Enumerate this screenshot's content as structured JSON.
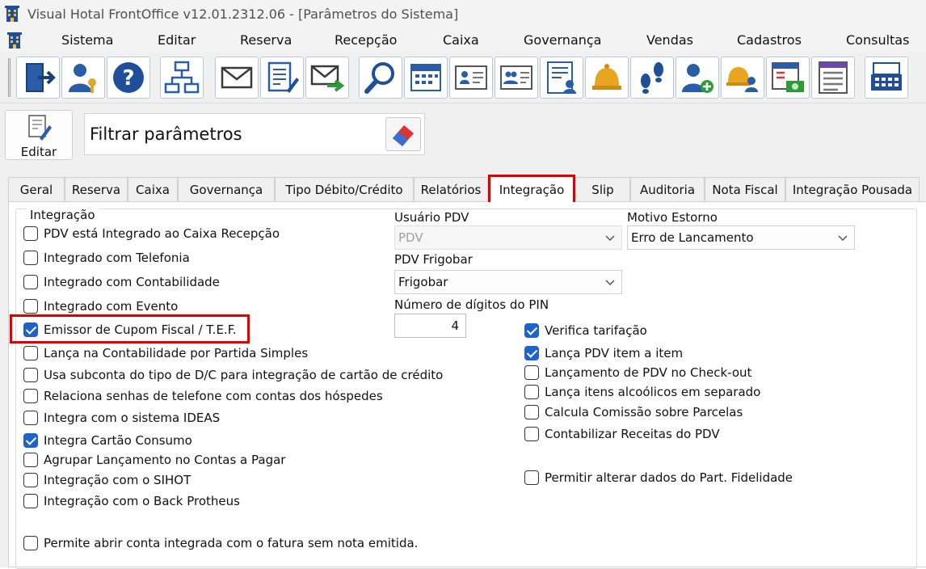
{
  "window": {
    "title": "Visual Hotal FrontOffice v12.01.2312.06 - [Parâmetros do Sistema]"
  },
  "menu": [
    {
      "label": "Sistema"
    },
    {
      "label": "Editar"
    },
    {
      "label": "Reserva"
    },
    {
      "label": "Recepção"
    },
    {
      "label": "Caixa"
    },
    {
      "label": "Governança"
    },
    {
      "label": "Vendas"
    },
    {
      "label": "Cadastros"
    },
    {
      "label": "Consultas"
    }
  ],
  "toolbar_icons": [
    "exit-door-icon",
    "user-key-icon",
    "help-icon",
    "org-chart-icon",
    "mail-icon",
    "document-edit-icon",
    "mail-forward-icon",
    "search-icon",
    "calendar-icon",
    "guest-card-icon",
    "guest-card-group-icon",
    "guest-list-icon",
    "bell-icon",
    "footprints-icon",
    "add-user-icon",
    "bell-group-icon",
    "invoice-cash-icon",
    "list-form-icon",
    "cash-register-icon"
  ],
  "filter": {
    "edit_label": "Editar",
    "filter_label": "Filtrar parâmetros"
  },
  "tabs": [
    {
      "label": "Geral"
    },
    {
      "label": "Reserva"
    },
    {
      "label": "Caixa"
    },
    {
      "label": "Governança"
    },
    {
      "label": "Tipo Débito/Crédito"
    },
    {
      "label": "Relatórios"
    },
    {
      "label": "Integração"
    },
    {
      "label": "Slip"
    },
    {
      "label": "Auditoria"
    },
    {
      "label": "Nota Fiscal"
    },
    {
      "label": "Integração Pousada"
    }
  ],
  "group": {
    "label": "Integração",
    "left_checks": [
      {
        "label": "PDV está Integrado ao Caixa Recepção",
        "checked": false
      },
      {
        "label": "Integrado com Telefonia",
        "checked": false
      },
      {
        "label": "Integrado com Contabilidade",
        "checked": false
      },
      {
        "label": "Integrado com Evento",
        "checked": false
      },
      {
        "label": "Emissor de Cupom Fiscal / T.E.F.",
        "checked": true
      },
      {
        "label": "Lança na Contabilidade por Partida Simples",
        "checked": false
      },
      {
        "label": "Usa subconta do tipo de D/C para integração de cartão de crédito",
        "checked": false
      },
      {
        "label": "Relaciona senhas de telefone com contas dos hóspedes",
        "checked": false
      },
      {
        "label": "Integra com o sistema IDEAS",
        "checked": false
      },
      {
        "label": "Integra Cartão Consumo",
        "checked": true
      },
      {
        "label": "Agrupar Lançamento no Contas a Pagar",
        "checked": false
      },
      {
        "label": "Integração com o SIHOT",
        "checked": false
      },
      {
        "label": "Integração com o Back Protheus",
        "checked": false
      },
      {
        "label": "Permite abrir conta integrada com o fatura sem nota emitida.",
        "checked": false
      }
    ],
    "right_checks": [
      {
        "label": "Verifica tarifação",
        "checked": true
      },
      {
        "label": "Lança PDV item a item",
        "checked": true
      },
      {
        "label": "Lançamento de PDV no Check-out",
        "checked": false
      },
      {
        "label": "Lança itens alcoólicos em separado",
        "checked": false
      },
      {
        "label": "Calcula Comissão sobre Parcelas",
        "checked": false
      },
      {
        "label": "Contabilizar Receitas do PDV",
        "checked": false
      },
      {
        "label": "Permitir alterar dados do Part. Fidelidade",
        "checked": false
      }
    ],
    "usuario_pdv": {
      "label": "Usuário PDV",
      "value": "PDV"
    },
    "motivo_estorno": {
      "label": "Motivo Estorno",
      "value": "Erro de Lancamento"
    },
    "pdv_frigobar": {
      "label": "PDV Frigobar",
      "value": "Frigobar"
    },
    "pin_digits": {
      "label": "Número de dígitos do PIN",
      "value": "4"
    }
  }
}
